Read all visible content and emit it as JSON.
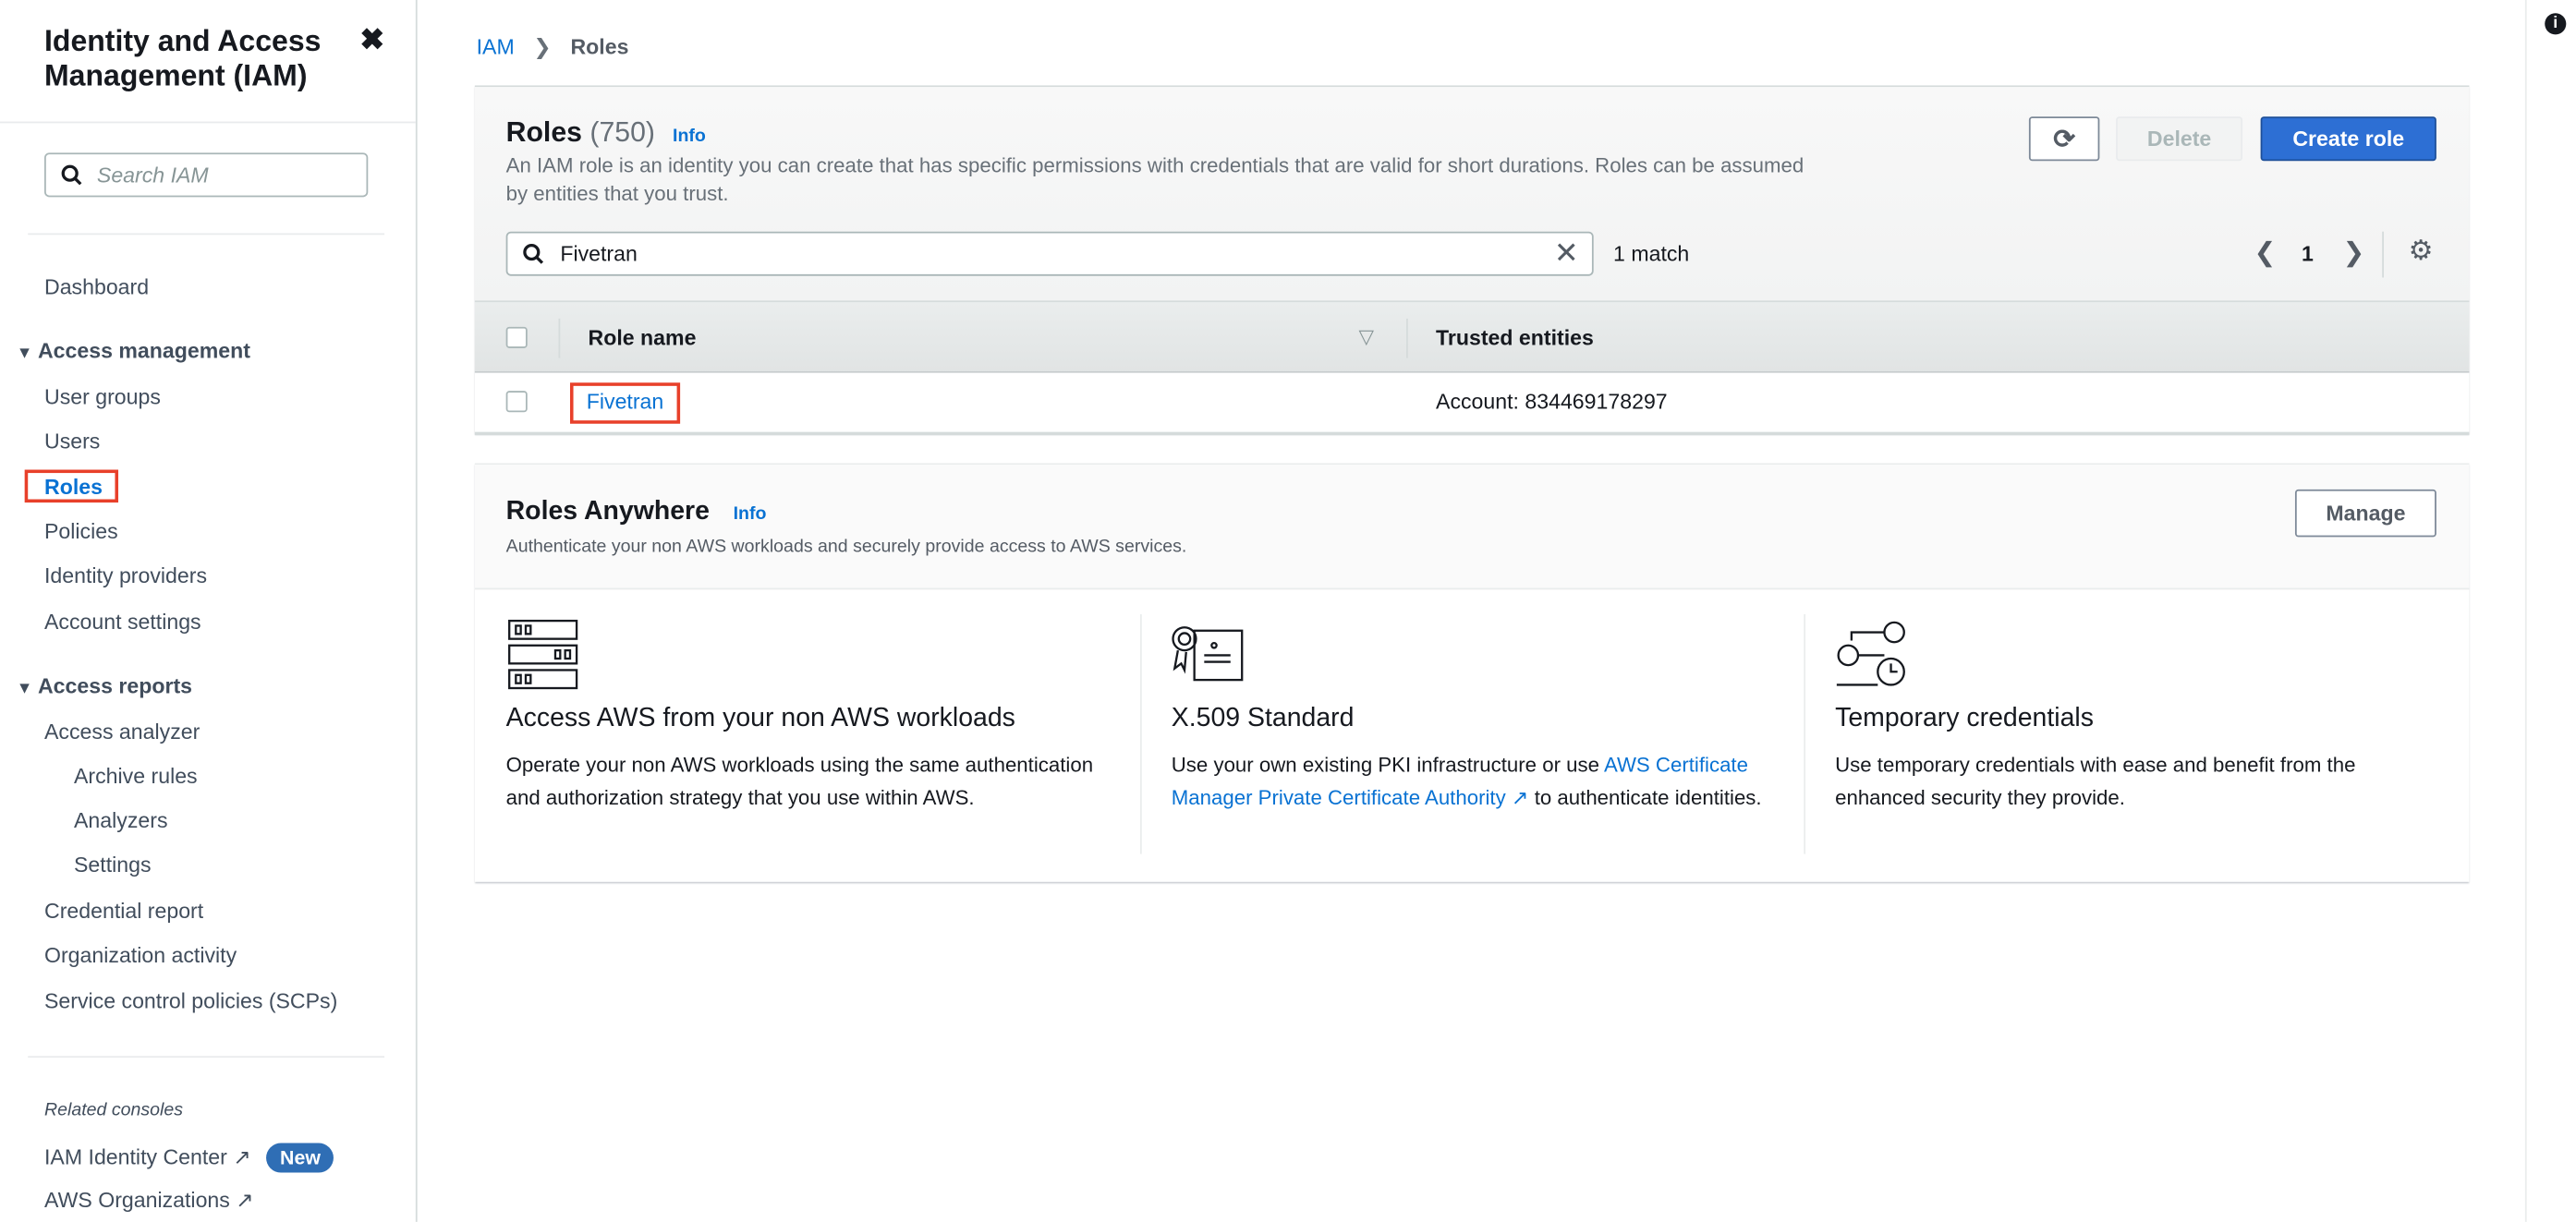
{
  "sidebar": {
    "title_line1": "Identity and Access",
    "title_line2": "Management (IAM)",
    "search_placeholder": "Search IAM",
    "dashboard": "Dashboard",
    "access_management": {
      "label": "Access management",
      "items": [
        "User groups",
        "Users",
        "Roles",
        "Policies",
        "Identity providers",
        "Account settings"
      ]
    },
    "access_reports": {
      "label": "Access reports",
      "items": [
        "Access analyzer",
        "Archive rules",
        "Analyzers",
        "Settings",
        "Credential report",
        "Organization activity",
        "Service control policies (SCPs)"
      ]
    },
    "related_label": "Related consoles",
    "related": [
      "IAM Identity Center",
      "AWS Organizations"
    ],
    "new_badge": "New",
    "active_item": "Roles"
  },
  "breadcrumb": [
    "IAM",
    "Roles"
  ],
  "roles": {
    "title": "Roles",
    "count": "(750)",
    "info": "Info",
    "description": "An IAM role is an identity you can create that has specific permissions with credentials that are valid for short durations. Roles can be assumed by entities that you trust.",
    "delete_label": "Delete",
    "create_label": "Create role",
    "filter_value": "Fivetran",
    "match_text": "1 match",
    "page": "1",
    "columns": [
      "Role name",
      "Trusted entities"
    ],
    "rows": [
      {
        "name": "Fivetran",
        "trusted": "Account: 834469178297"
      }
    ]
  },
  "anywhere": {
    "title": "Roles Anywhere",
    "info": "Info",
    "subtitle": "Authenticate your non AWS workloads and securely provide access to AWS services.",
    "manage_label": "Manage",
    "columns": [
      {
        "icon": "server-rack-icon",
        "title": "Access AWS from your non AWS workloads",
        "text": "Operate your non AWS workloads using the same authentication and authorization strategy that you use within AWS."
      },
      {
        "icon": "certificate-icon",
        "title": "X.509 Standard",
        "text_before": "Use your own existing PKI infrastructure or use ",
        "link": "AWS Certificate Manager Private Certificate Authority",
        "text_after": " to authenticate identities."
      },
      {
        "icon": "keys-clock-icon",
        "title": "Temporary credentials",
        "text": "Use temporary credentials with ease and benefit from the enhanced security they provide."
      }
    ]
  },
  "colors": {
    "primary": "#0972d3",
    "highlight": "#e8402a",
    "badge": "#2f6eb5"
  }
}
